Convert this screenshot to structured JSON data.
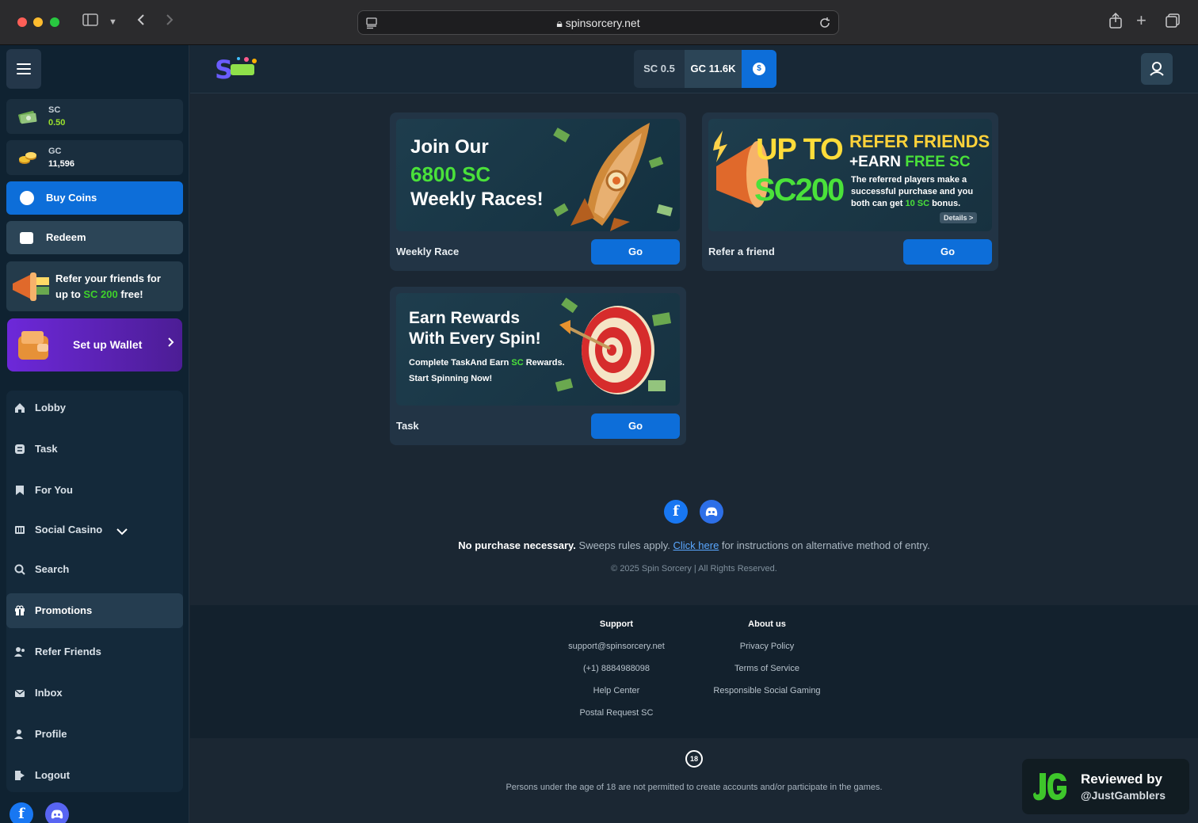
{
  "browser": {
    "url": "spinsorcery.net"
  },
  "header": {
    "currency_sc": "SC 0.5",
    "currency_gc": "GC 11.6K"
  },
  "sidebar": {
    "balances": [
      {
        "label": "SC",
        "value": "0.50",
        "color": "#9be22d"
      },
      {
        "label": "GC",
        "value": "11,596",
        "color": "#ffffff"
      }
    ],
    "buy_coins": "Buy Coins",
    "redeem": "Redeem",
    "refer_line1": "Refer your friends for",
    "refer_line2_pre": "up to ",
    "refer_line2_hl": "SC 200",
    "refer_line2_post": " free!",
    "wallet": "Set up Wallet",
    "nav": [
      {
        "label": "Lobby",
        "icon": "home-icon"
      },
      {
        "label": "Task",
        "icon": "task-icon"
      },
      {
        "label": "For You",
        "icon": "bookmark-icon"
      },
      {
        "label": "Social Casino",
        "icon": "slot-icon"
      },
      {
        "label": "Search",
        "icon": "search-icon"
      },
      {
        "label": "Promotions",
        "icon": "gift-icon"
      },
      {
        "label": "Refer Friends",
        "icon": "users-icon"
      },
      {
        "label": "Inbox",
        "icon": "mail-icon"
      },
      {
        "label": "Profile",
        "icon": "profile-icon"
      },
      {
        "label": "Logout",
        "icon": "logout-icon"
      }
    ]
  },
  "promos": [
    {
      "name": "Weekly Race",
      "button": "Go",
      "banner_l1": "Join Our",
      "banner_l2": "6800 SC",
      "banner_l3": "Weekly Races!"
    },
    {
      "name": "Refer a friend",
      "button": "Go",
      "banner_big1": "UP TO",
      "banner_big2": "SC200",
      "banner_title": "REFER FRIENDS",
      "banner_sub_pre": "+EARN ",
      "banner_sub_hl": "FREE SC",
      "banner_desc1": "The referred players make a",
      "banner_desc2": "successful purchase and you",
      "banner_desc3_pre": "both can get ",
      "banner_desc3_hl": "10 SC",
      "banner_desc3_post": " bonus.",
      "details": "Details >"
    },
    {
      "name": "Task",
      "button": "Go",
      "banner_l1": "Earn Rewards",
      "banner_l2": "With Every Spin!",
      "banner_l3_pre": "Complete TaskAnd Earn ",
      "banner_l3_hl": "SC",
      "banner_l3_post": " Rewards.",
      "banner_l4": "Start Spinning Now!"
    }
  ],
  "disclaimer": {
    "bold": "No purchase necessary.",
    "text1": " Sweeps rules apply. ",
    "link": "Click here",
    "text2": " for instructions on alternative method of entry."
  },
  "copyright": "© 2025 Spin Sorcery | All Rights Reserved.",
  "footer": {
    "support_heading": "Support",
    "support_items": [
      "support@spinsorcery.net",
      "(+1) 8884988098",
      "Help Center",
      "Postal Request SC"
    ],
    "about_heading": "About us",
    "about_items": [
      "Privacy Policy",
      "Terms of Service",
      "Responsible Social Gaming"
    ]
  },
  "age_badge": "18",
  "age_text": "Persons under the age of 18 are not permitted to create accounts and/or participate in the games.",
  "badge": {
    "line1": "Reviewed by",
    "line2": "@JustGamblers"
  }
}
